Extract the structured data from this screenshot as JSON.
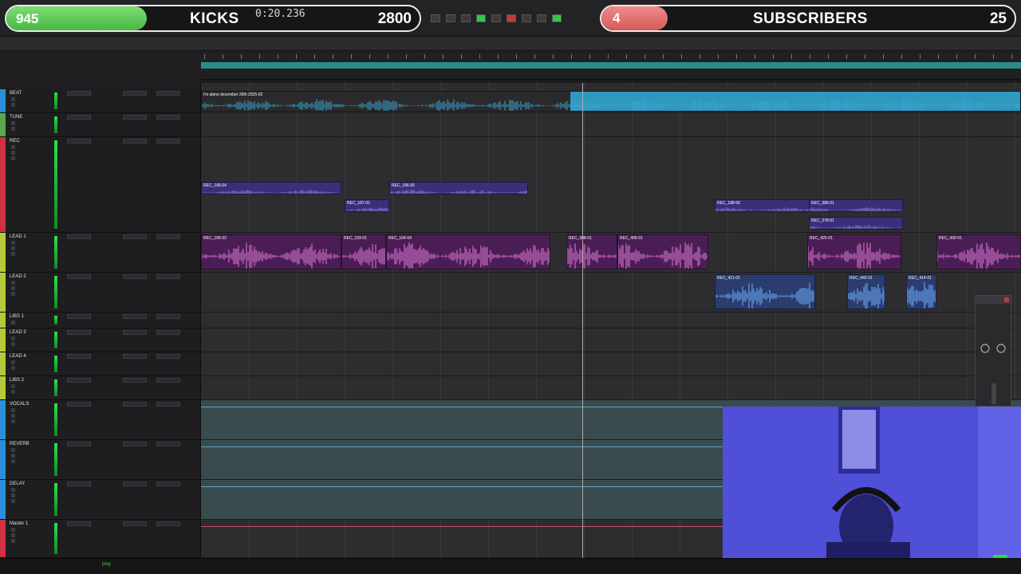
{
  "overlay": {
    "kicks": {
      "current": "945",
      "label": "KICKS",
      "goal": "2800",
      "fraction": 0.34
    },
    "subscribers": {
      "current": "4",
      "label": "SUBSCRIBERS",
      "goal": "25",
      "fraction": 0.16
    }
  },
  "transport": {
    "main_counter": "0:20.236"
  },
  "colors": {
    "kicks_fill": "#5fce58",
    "subs_fill": "#e27070",
    "aux_lane": "#3a4b4e",
    "master_line": "#c6506a",
    "meter_green": "#2de04a"
  },
  "tracks": [
    {
      "name": "BEAT",
      "color": "#2a8fd6",
      "kind": "audio"
    },
    {
      "name": "TUNE",
      "color": "#5ca64b",
      "kind": "audio"
    },
    {
      "name": "REC",
      "color": "#d03040",
      "kind": "audio"
    },
    {
      "name": "LEAD 1",
      "color": "#b7c93a",
      "kind": "audio"
    },
    {
      "name": "LEAD 2",
      "color": "#b7c93a",
      "kind": "audio"
    },
    {
      "name": "LIBS 1",
      "color": "#b7c93a",
      "kind": "audio"
    },
    {
      "name": "LEAD 3",
      "color": "#b7c93a",
      "kind": "audio"
    },
    {
      "name": "LEAD 4",
      "color": "#b7c93a",
      "kind": "audio"
    },
    {
      "name": "LIBS 2",
      "color": "#b7c93a",
      "kind": "audio"
    },
    {
      "name": "VOCALS",
      "color": "#2a8fd6",
      "kind": "aux"
    },
    {
      "name": "REVERB",
      "color": "#2a8fd6",
      "kind": "aux"
    },
    {
      "name": "DELAY",
      "color": "#2a8fd6",
      "kind": "aux"
    },
    {
      "name": "Master 1",
      "color": "#d03040",
      "kind": "master"
    }
  ],
  "clips": [
    {
      "name": "i'm alone december 26th 2025-02",
      "lane": "BEAT",
      "style": "beat"
    },
    {
      "name": "REC_106-04",
      "lane": "REC",
      "style": "purple"
    },
    {
      "name": "REC_187-01",
      "lane": "REC",
      "style": "purple"
    },
    {
      "name": "REC_186-05",
      "lane": "REC",
      "style": "purple"
    },
    {
      "name": "REC_188-06",
      "lane": "REC",
      "style": "purple"
    },
    {
      "name": "REC_386-01",
      "lane": "REC",
      "style": "purple"
    },
    {
      "name": "REC_378-01",
      "lane": "REC",
      "style": "purple"
    },
    {
      "name": "REC_106-02",
      "lane": "LEAD 1",
      "style": "pink"
    },
    {
      "name": "REC_193-01",
      "lane": "LEAD 1",
      "style": "pink"
    },
    {
      "name": "REC_104-04",
      "lane": "LEAD 1",
      "style": "pink"
    },
    {
      "name": "REC_308-01",
      "lane": "LEAD 1",
      "style": "pink"
    },
    {
      "name": "REC_406-01",
      "lane": "LEAD 1",
      "style": "pink"
    },
    {
      "name": "REC_425-01",
      "lane": "LEAD 1",
      "style": "pink"
    },
    {
      "name": "REC_430-01",
      "lane": "LEAD 1",
      "style": "pink"
    },
    {
      "name": "REC_421-01",
      "lane": "LEAD 2",
      "style": "lblue"
    },
    {
      "name": "REC_442-01",
      "lane": "LEAD 2",
      "style": "lblue"
    },
    {
      "name": "REC_414-01",
      "lane": "LEAD 2",
      "style": "lblue"
    }
  ],
  "bottom": {
    "status": "play"
  }
}
